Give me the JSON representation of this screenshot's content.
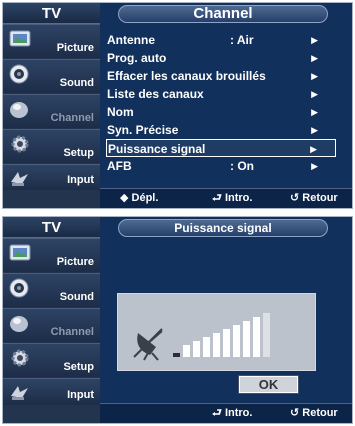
{
  "menu_screen": {
    "sidebar": {
      "title": "TV",
      "items": [
        {
          "label": "Picture",
          "icon": "picture-icon",
          "dim": false
        },
        {
          "label": "Sound",
          "icon": "sound-icon",
          "dim": false
        },
        {
          "label": "Channel",
          "icon": "channel-icon",
          "dim": true
        },
        {
          "label": "Setup",
          "icon": "setup-icon",
          "dim": false
        },
        {
          "label": "Input",
          "icon": "input-icon",
          "dim": false
        }
      ]
    },
    "title": "Channel",
    "menu_items": [
      {
        "label": "Antenne",
        "value": ": Air",
        "arrow": "▶"
      },
      {
        "label": "Prog. auto",
        "value": "",
        "arrow": "▶"
      },
      {
        "label": "Effacer les canaux brouillés",
        "value": "",
        "arrow": "▶"
      },
      {
        "label": "Liste des canaux",
        "value": "",
        "arrow": "▶"
      },
      {
        "label": "Nom",
        "value": "",
        "arrow": "▶"
      },
      {
        "label": "Syn. Précise",
        "value": "",
        "arrow": "▶"
      },
      {
        "label": "Puissance signal",
        "value": "",
        "arrow": "▶"
      },
      {
        "label": "AFB",
        "value": ": On",
        "arrow": "▶"
      }
    ],
    "selected_index": 6,
    "bottom": {
      "move": "◆ Dépl.",
      "enter": "⮐ Intro.",
      "back": "↺ Retour"
    }
  },
  "signal_screen": {
    "sidebar": {
      "title": "TV",
      "items": [
        {
          "label": "Picture",
          "icon": "picture-icon",
          "dim": false
        },
        {
          "label": "Sound",
          "icon": "sound-icon",
          "dim": false
        },
        {
          "label": "Channel",
          "icon": "channel-icon",
          "dim": true
        },
        {
          "label": "Setup",
          "icon": "setup-icon",
          "dim": false
        },
        {
          "label": "Input",
          "icon": "input-icon",
          "dim": false
        }
      ]
    },
    "title": "Puissance signal",
    "signal": {
      "bars_total": 10,
      "bars_lit": 9,
      "icon": "satellite-dish-icon"
    },
    "ok_label": "OK",
    "bottom": {
      "enter": "⮐ Intro.",
      "back": "↺ Retour"
    }
  },
  "colors": {
    "background": "#12305c",
    "sidebar": "#23344f",
    "panel": "#bcc2cc",
    "bar_lit": "#ffffff",
    "bar_dim": "#dde0e5"
  }
}
